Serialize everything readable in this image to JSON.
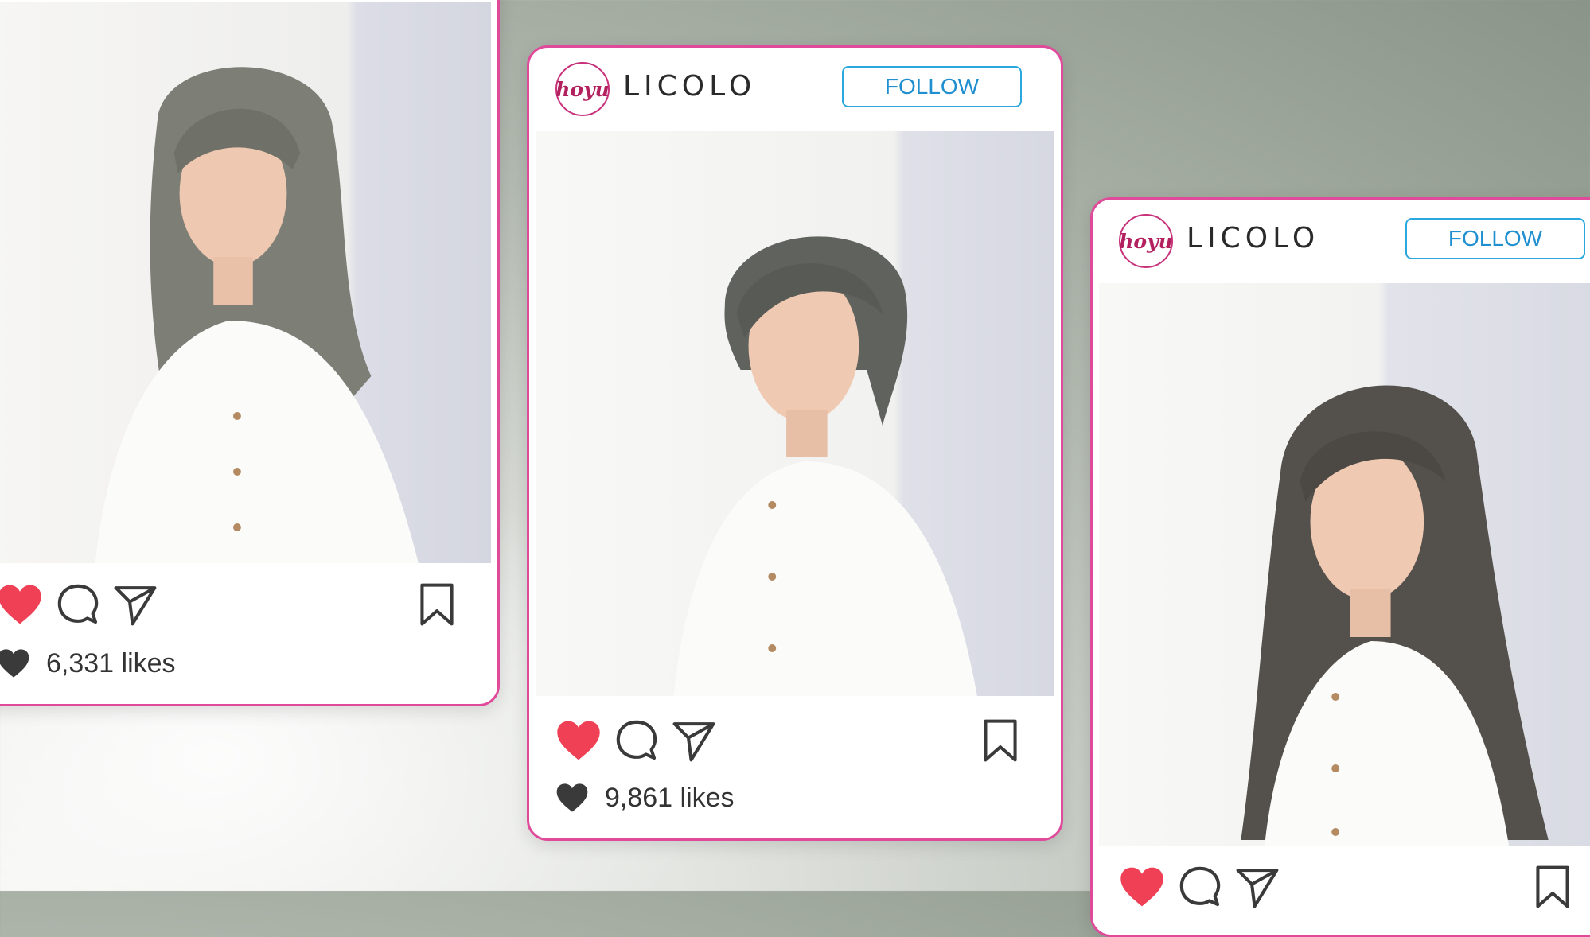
{
  "colors": {
    "card_border": "#e04a9a",
    "follow_blue": "#2aa7df",
    "heart_red": "#ef4056",
    "icon_dark": "#3a3a3a"
  },
  "posts": [
    {
      "id": "left",
      "brand_logo": "",
      "brand_name": "",
      "follow_label": "",
      "likes_text": "6,331 likes",
      "liked": true
    },
    {
      "id": "center",
      "brand_logo": "hoyu",
      "brand_name": "LICOLO",
      "follow_label": "FOLLOW",
      "likes_text": "9,861 likes",
      "liked": true
    },
    {
      "id": "right",
      "brand_logo": "hoyu",
      "brand_name": "LICOLO",
      "follow_label": "FOLLOW",
      "likes_text": "",
      "liked": true
    }
  ],
  "icons": {
    "like": "heart-icon",
    "comment": "comment-bubble-icon",
    "share": "paper-plane-icon",
    "save": "bookmark-icon",
    "likes_count": "heart-filled-icon"
  }
}
